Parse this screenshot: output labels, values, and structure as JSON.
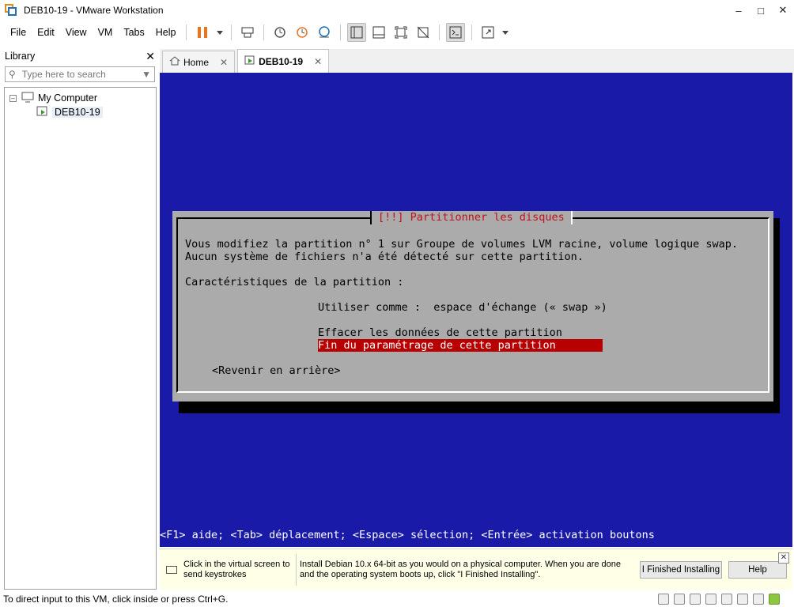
{
  "window": {
    "title": "DEB10-19 - VMware Workstation"
  },
  "menu": [
    "File",
    "Edit",
    "View",
    "VM",
    "Tabs",
    "Help"
  ],
  "library": {
    "title": "Library",
    "search_placeholder": "Type here to search",
    "root": "My Computer",
    "vm": "DEB10-19"
  },
  "tabs": [
    {
      "label": "Home"
    },
    {
      "label": "DEB10-19"
    }
  ],
  "installer": {
    "dialog_title": "[!!] Partitionner les disques",
    "line1": "Vous modifiez la partition n° 1 sur Groupe de volumes LVM racine, volume logique swap.",
    "line2": "Aucun système de fichiers n'a été détecté sur cette partition.",
    "line3": "Caractéristiques de la partition :",
    "use_as": "Utiliser comme :  espace d'échange (« swap »)",
    "erase": "Effacer les données de cette partition",
    "finish": "Fin du paramétrage de cette partition",
    "back": "<Revenir en arrière>",
    "help": "<F1> aide; <Tab> déplacement; <Espace> sélection; <Entrée> activation boutons"
  },
  "notification": {
    "click_text": "Click in the virtual screen to send keystrokes",
    "install_text": "Install Debian 10.x 64-bit as you would on a physical computer. When you are done and the operating system boots up, click \"I Finished Installing\".",
    "finished_button": "I Finished Installing",
    "help_button": "Help"
  },
  "status": {
    "text": "To direct input to this VM, click inside or press Ctrl+G."
  }
}
